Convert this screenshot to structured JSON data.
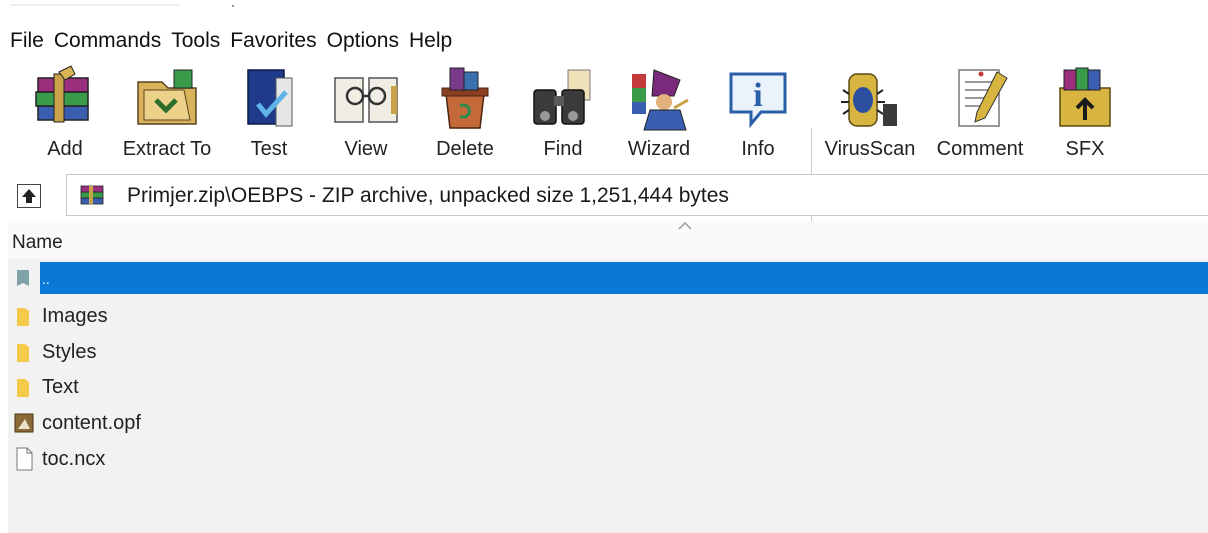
{
  "menu": [
    "File",
    "Commands",
    "Tools",
    "Favorites",
    "Options",
    "Help"
  ],
  "toolbar": [
    {
      "label": "Add",
      "icon": "add-archive-icon"
    },
    {
      "label": "Extract To",
      "icon": "extract-to-icon"
    },
    {
      "label": "Test",
      "icon": "test-archive-icon"
    },
    {
      "label": "View",
      "icon": "view-glasses-icon"
    },
    {
      "label": "Delete",
      "icon": "delete-icon"
    },
    {
      "label": "Find",
      "icon": "find-binoculars-icon"
    },
    {
      "label": "Wizard",
      "icon": "wizard-icon"
    },
    {
      "label": "Info",
      "icon": "info-icon"
    },
    {
      "label": "VirusScan",
      "icon": "virus-scan-icon"
    },
    {
      "label": "Comment",
      "icon": "comment-icon"
    },
    {
      "label": "SFX",
      "icon": "sfx-icon"
    }
  ],
  "address": {
    "archive_name": "Primjer",
    "rest": ".zip\\OEBPS - ZIP archive, unpacked size 1,251,444 bytes"
  },
  "list": {
    "column_name": "Name",
    "rows": [
      {
        "name": "..",
        "type": "parent-folder",
        "selected": true
      },
      {
        "name": "Images",
        "type": "folder"
      },
      {
        "name": "Styles",
        "type": "folder"
      },
      {
        "name": "Text",
        "type": "folder"
      },
      {
        "name": "content.opf",
        "type": "opf-file"
      },
      {
        "name": "toc.ncx",
        "type": "file"
      }
    ]
  },
  "colors": {
    "selection": "#0a78d7",
    "list_background": "#f2f2f2",
    "folder": "#f5c94a"
  }
}
